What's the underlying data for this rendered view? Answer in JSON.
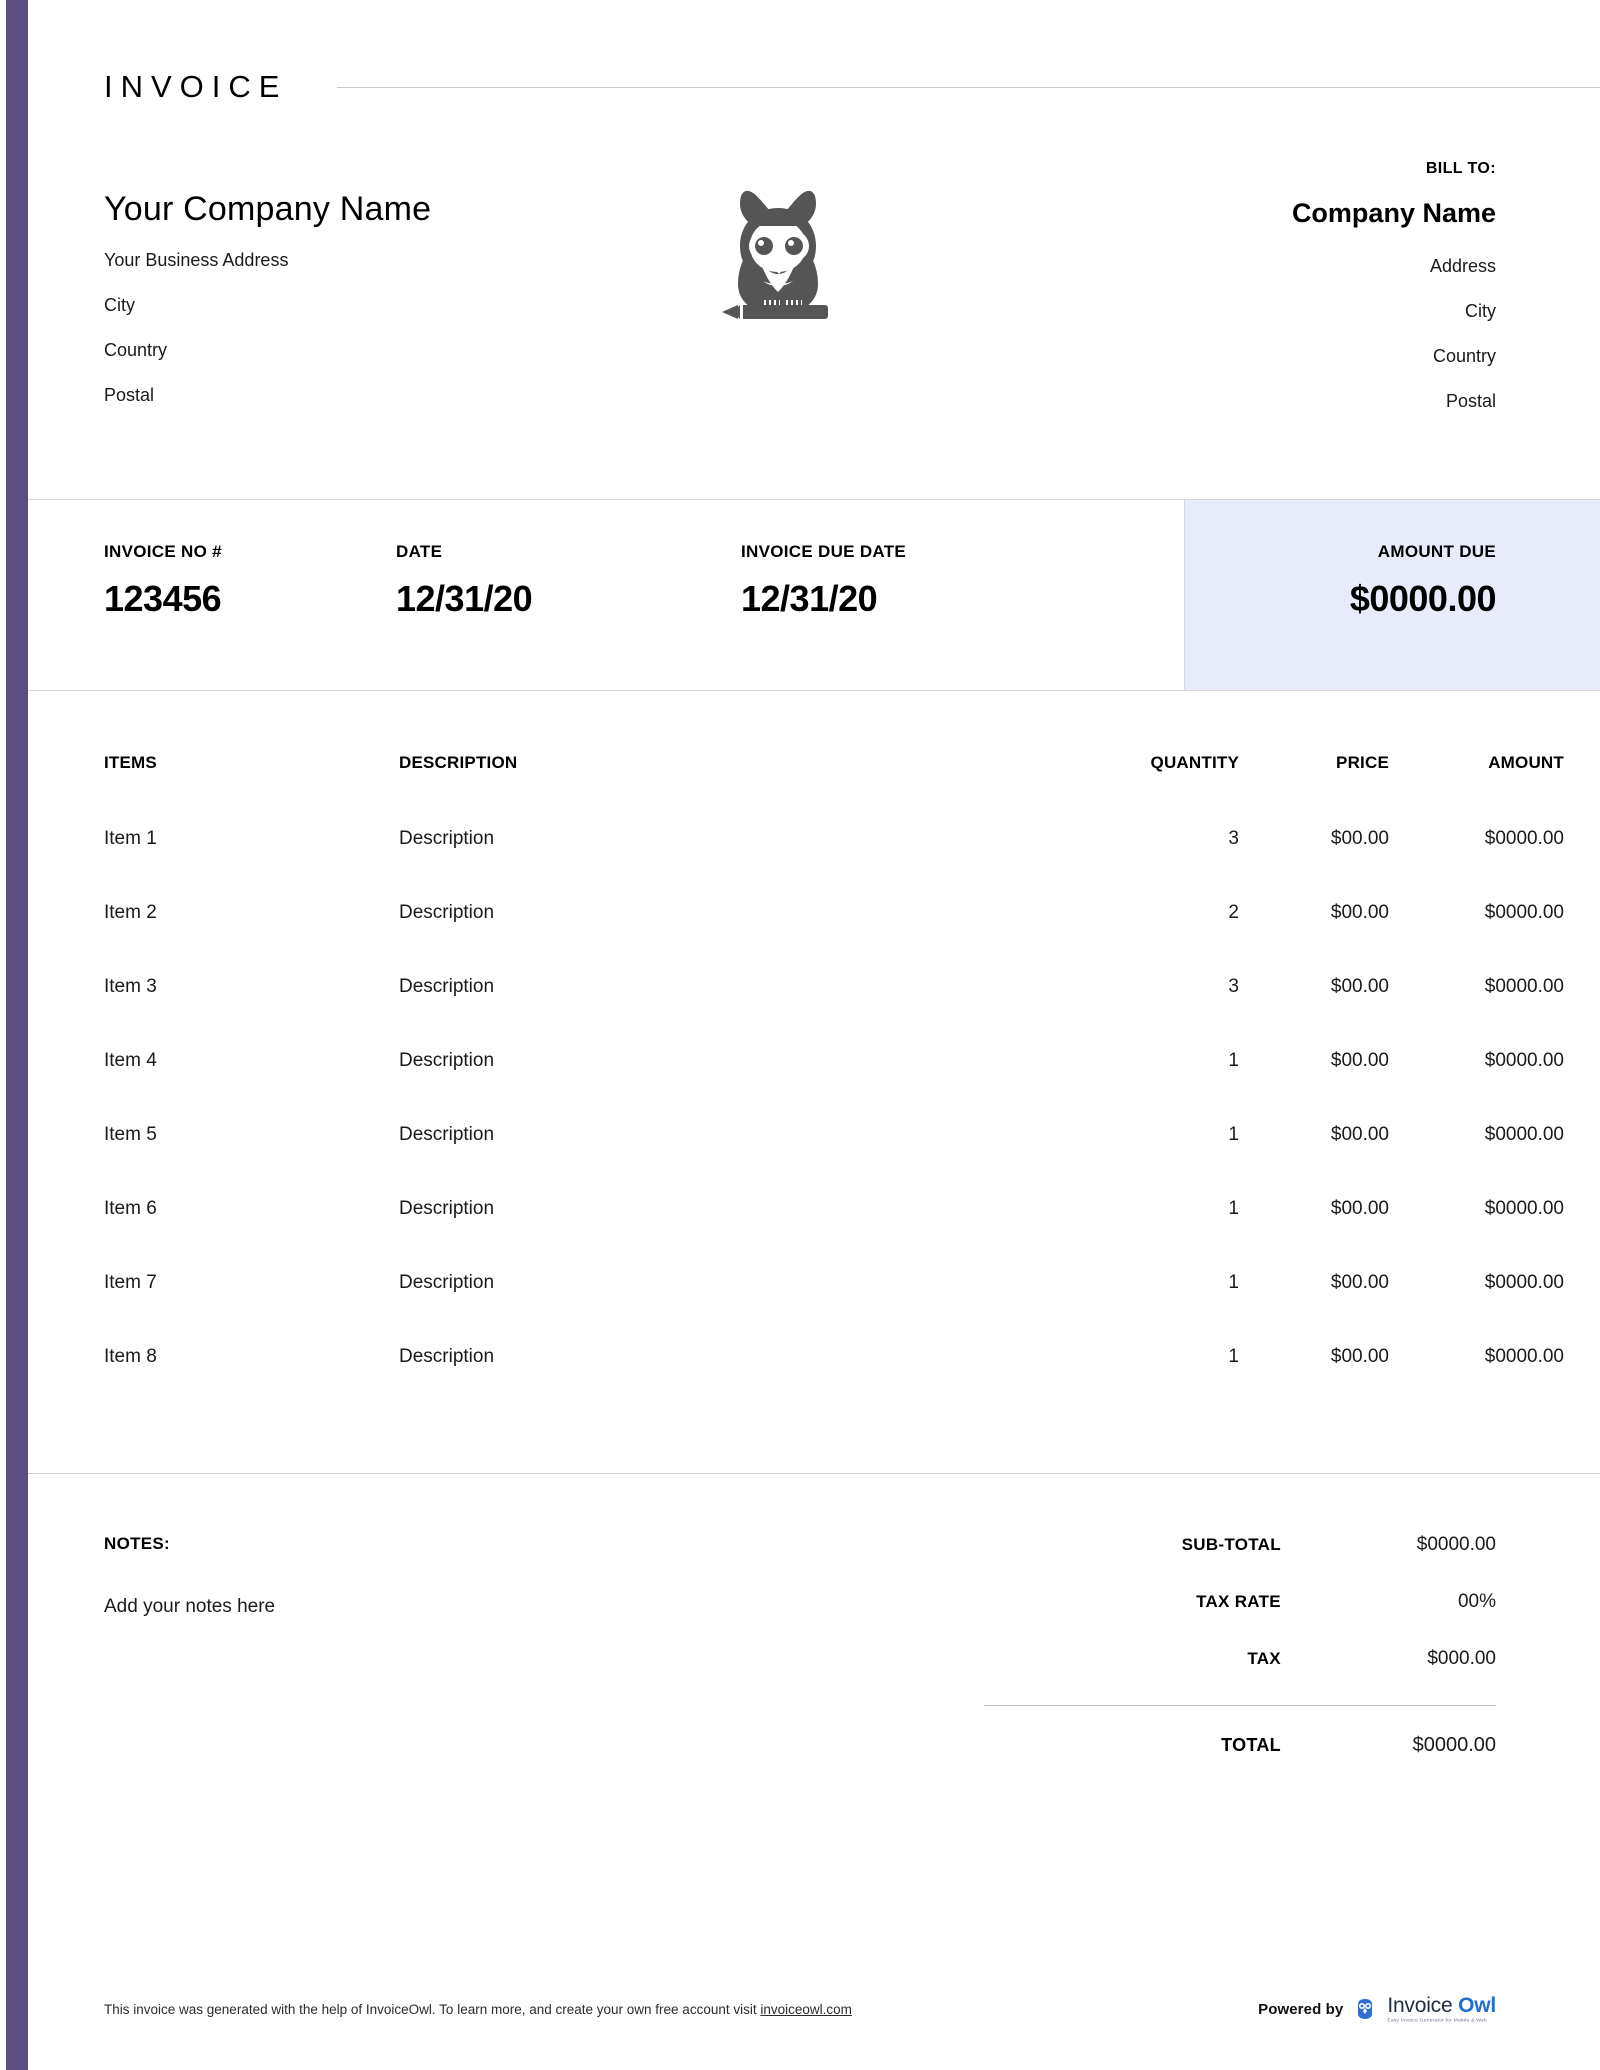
{
  "document": {
    "title": "INVOICE"
  },
  "seller": {
    "company_name": "Your Company Name",
    "address_lines": [
      "Your Business Address",
      "City",
      "Country",
      "Postal"
    ]
  },
  "logo": {
    "icon": "owl-with-pencil-icon",
    "color": "#555555"
  },
  "bill_to": {
    "label": "BILL TO:",
    "company_name": "Company Name",
    "address_lines": [
      "Address",
      "City",
      "Country",
      "Postal"
    ]
  },
  "meta": {
    "invoice_no": {
      "label": "INVOICE NO #",
      "value": "123456"
    },
    "date": {
      "label": "DATE",
      "value": "12/31/20"
    },
    "due_date": {
      "label": "INVOICE DUE DATE",
      "value": "12/31/20"
    },
    "amount_due": {
      "label": "AMOUNT DUE",
      "value": "$0000.00",
      "background": "#e7ebfa"
    }
  },
  "items_table": {
    "headers": {
      "items": "ITEMS",
      "description": "DESCRIPTION",
      "quantity": "QUANTITY",
      "price": "PRICE",
      "amount": "AMOUNT"
    },
    "rows": [
      {
        "item": "Item 1",
        "description": "Description",
        "quantity": "3",
        "price": "$00.00",
        "amount": "$0000.00"
      },
      {
        "item": "Item 2",
        "description": "Description",
        "quantity": "2",
        "price": "$00.00",
        "amount": "$0000.00"
      },
      {
        "item": "Item 3",
        "description": "Description",
        "quantity": "3",
        "price": "$00.00",
        "amount": "$0000.00"
      },
      {
        "item": "Item 4",
        "description": "Description",
        "quantity": "1",
        "price": "$00.00",
        "amount": "$0000.00"
      },
      {
        "item": "Item 5",
        "description": "Description",
        "quantity": "1",
        "price": "$00.00",
        "amount": "$0000.00"
      },
      {
        "item": "Item 6",
        "description": "Description",
        "quantity": "1",
        "price": "$00.00",
        "amount": "$0000.00"
      },
      {
        "item": "Item 7",
        "description": "Description",
        "quantity": "1",
        "price": "$00.00",
        "amount": "$0000.00"
      },
      {
        "item": "Item 8",
        "description": "Description",
        "quantity": "1",
        "price": "$00.00",
        "amount": "$0000.00"
      }
    ]
  },
  "notes": {
    "label": "NOTES:",
    "text": "Add your notes here"
  },
  "totals": {
    "sub_total": {
      "label": "SUB-TOTAL",
      "value": "$0000.00"
    },
    "tax_rate": {
      "label": "TAX RATE",
      "value": "00%"
    },
    "tax": {
      "label": "TAX",
      "value": "$000.00"
    },
    "total": {
      "label": "TOTAL",
      "value": "$0000.00"
    }
  },
  "footer": {
    "note_prefix": "This invoice was generated with the help of InvoiceOwl. To learn more, and create your own free account visit ",
    "note_link": "invoiceowl.com",
    "powered_label": "Powered by",
    "brand_first": "Invoice",
    "brand_second": "Owl",
    "brand_tagline": "Easy Invoice Generator for Mobile & Web"
  },
  "theme": {
    "accent_purple": "#5d4e80",
    "amount_due_bg": "#e7ebfa",
    "brand_blue": "#1f6fd0"
  }
}
